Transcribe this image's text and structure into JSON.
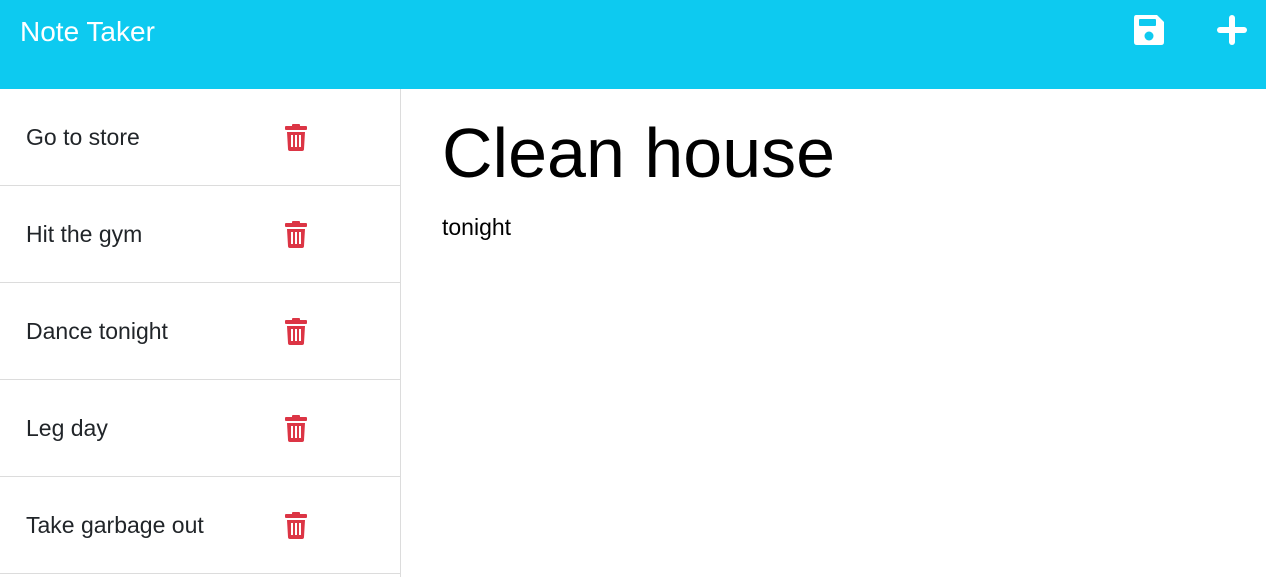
{
  "app": {
    "title": "Note Taker"
  },
  "toolbar": {
    "save_icon": "floppy-disk-icon",
    "new_icon": "plus-icon",
    "icon_color": "#ffffff"
  },
  "notes": [
    {
      "title": "Go to store",
      "delete_icon": "trash-icon"
    },
    {
      "title": "Hit the gym",
      "delete_icon": "trash-icon"
    },
    {
      "title": "Dance tonight",
      "delete_icon": "trash-icon"
    },
    {
      "title": "Leg day",
      "delete_icon": "trash-icon"
    },
    {
      "title": "Take garbage out",
      "delete_icon": "trash-icon"
    }
  ],
  "active_note": {
    "title": "Clean house",
    "text": "tonight"
  },
  "colors": {
    "navbar": "#0dcaf0",
    "delete": "#dc3545"
  }
}
